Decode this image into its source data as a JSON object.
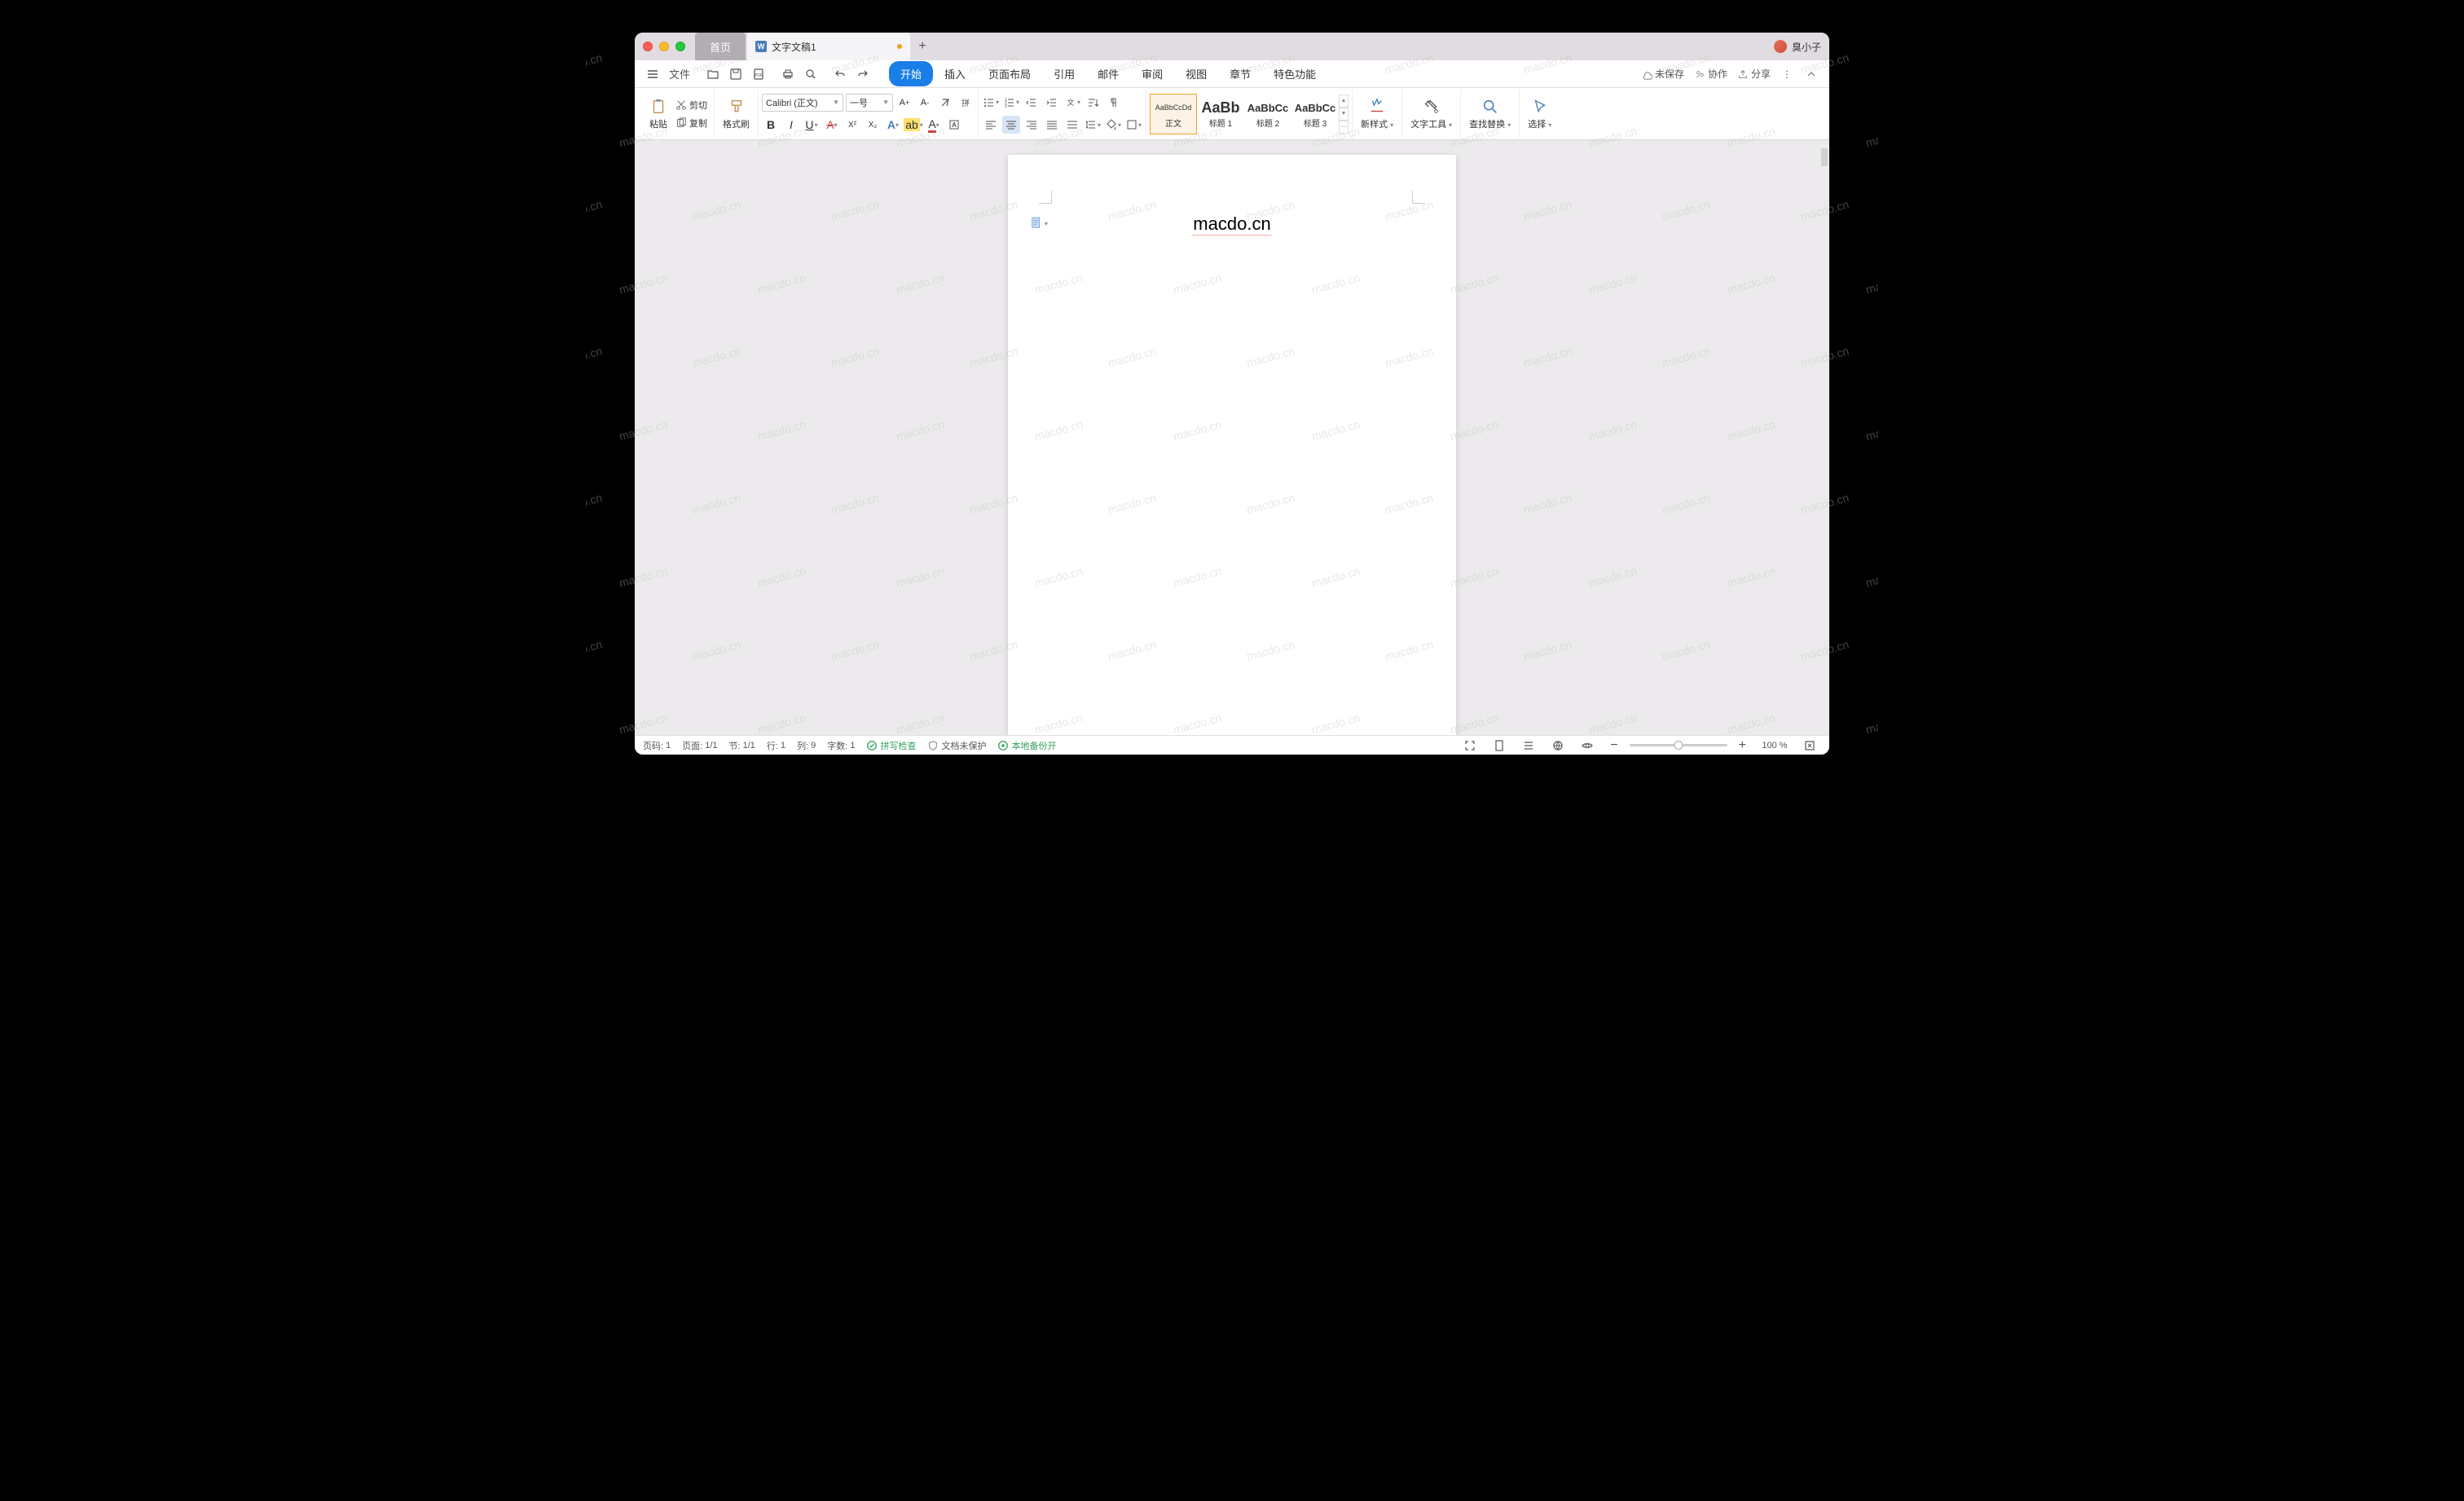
{
  "titlebar": {
    "home_tab": "首页",
    "doc_tab": "文字文稿1",
    "username": "臭小子"
  },
  "menubar": {
    "file": "文件",
    "tabs": [
      "开始",
      "插入",
      "页面布局",
      "引用",
      "邮件",
      "审阅",
      "视图",
      "章节",
      "特色功能"
    ],
    "active_tab": 0,
    "unsaved": "未保存",
    "collab": "协作",
    "share": "分享"
  },
  "ribbon": {
    "paste": "粘贴",
    "cut": "剪切",
    "copy": "复制",
    "format_painter": "格式刷",
    "font_name": "Calibri (正文)",
    "font_size": "一号",
    "styles": {
      "normal_preview": "AaBbCcDd",
      "normal_label": "正文",
      "h1_preview": "AaBb",
      "h1_label": "标题 1",
      "h2_preview": "AaBbCc",
      "h2_label": "标题 2",
      "h3_preview": "AaBbCc",
      "h3_label": "标题 3"
    },
    "new_style": "新样式",
    "text_tools": "文字工具",
    "find_replace": "查找替换",
    "select": "选择"
  },
  "document": {
    "text": "macdo.cn"
  },
  "statusbar": {
    "page_no_label": "页码:",
    "page_no": "1",
    "page_label": "页面:",
    "page": "1/1",
    "section_label": "节:",
    "section": "1/1",
    "row_label": "行:",
    "row": "1",
    "col_label": "列:",
    "col": "9",
    "wordcount_label": "字数:",
    "wordcount": "1",
    "spellcheck": "拼写检查",
    "doc_protect": "文档未保护",
    "backup": "本地备份开",
    "zoom": "100 %"
  },
  "watermark_text": "macdo.cn"
}
